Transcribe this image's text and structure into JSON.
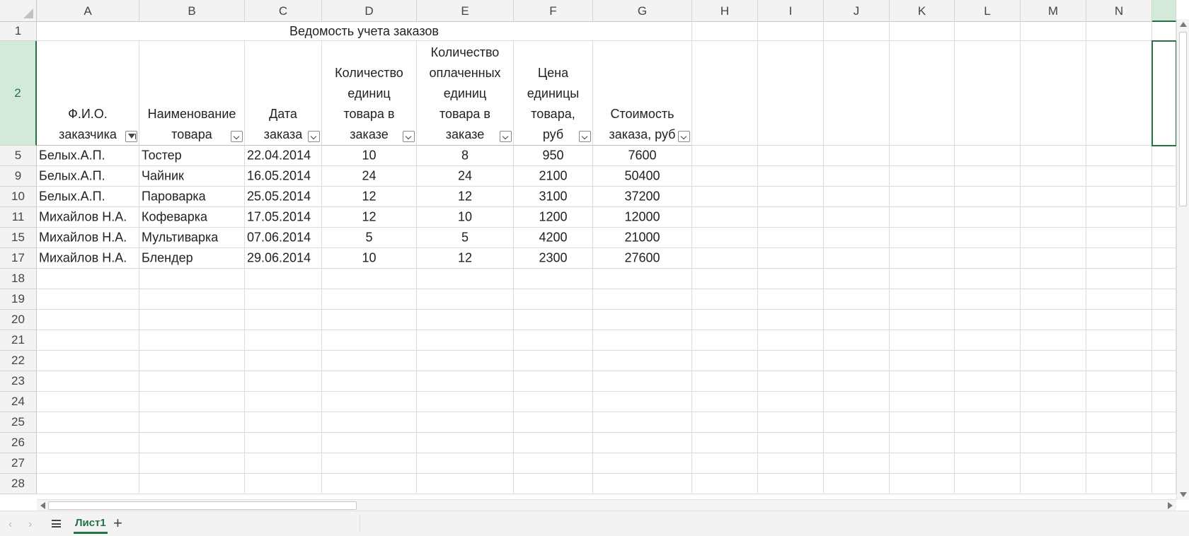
{
  "columns": [
    "A",
    "B",
    "C",
    "D",
    "E",
    "F",
    "G",
    "H",
    "I",
    "J",
    "K",
    "L",
    "M",
    "N"
  ],
  "rows": {
    "title": "1",
    "header": "2",
    "data": [
      "5",
      "9",
      "10",
      "11",
      "15",
      "17"
    ],
    "empty": [
      "18",
      "19",
      "20",
      "21",
      "22",
      "23",
      "24",
      "25",
      "26",
      "27",
      "28"
    ]
  },
  "sheet_title": "Ведомость учета заказов",
  "headers": [
    {
      "lines": [
        "Ф.И.О.",
        "заказчика"
      ]
    },
    {
      "lines": [
        "Наименование",
        "товара"
      ]
    },
    {
      "lines": [
        "Дата",
        "заказа"
      ]
    },
    {
      "lines": [
        "Количество",
        "единиц",
        "товара в",
        "заказе"
      ]
    },
    {
      "lines": [
        "Количество",
        "оплаченных",
        "единиц",
        "товара в",
        "заказе"
      ]
    },
    {
      "lines": [
        "Цена",
        "единицы",
        "товара,",
        "руб"
      ]
    },
    {
      "lines": [
        "Стоимость",
        "заказа, руб"
      ]
    }
  ],
  "table": [
    [
      "Белых.А.П.",
      "Тостер",
      "22.04.2014",
      "10",
      "8",
      "950",
      "7600"
    ],
    [
      "Белых.А.П.",
      "Чайник",
      "16.05.2014",
      "24",
      "24",
      "2100",
      "50400"
    ],
    [
      "Белых.А.П.",
      "Пароварка",
      "25.05.2014",
      "12",
      "12",
      "3100",
      "37200"
    ],
    [
      "Михайлов Н.А.",
      "Кофеварка",
      "17.05.2014",
      "12",
      "10",
      "1200",
      "12000"
    ],
    [
      "Михайлов Н.А.",
      "Мультиварка",
      "07.06.2014",
      "5",
      "5",
      "4200",
      "21000"
    ],
    [
      "Михайлов Н.А.",
      "Блендер",
      "29.06.2014",
      "10",
      "12",
      "2300",
      "27600"
    ]
  ],
  "tabs": {
    "prev_icon": "chevron-left-icon",
    "next_icon": "chevron-right-icon",
    "menu_icon": "hamburger-icon",
    "sheet_name": "Лист1",
    "add_label": "+"
  },
  "colors": {
    "accent": "#217346",
    "selection_header_bg": "#d3eadb",
    "header_bg": "#f3f3f3",
    "grid_line": "#dcdcdc"
  }
}
